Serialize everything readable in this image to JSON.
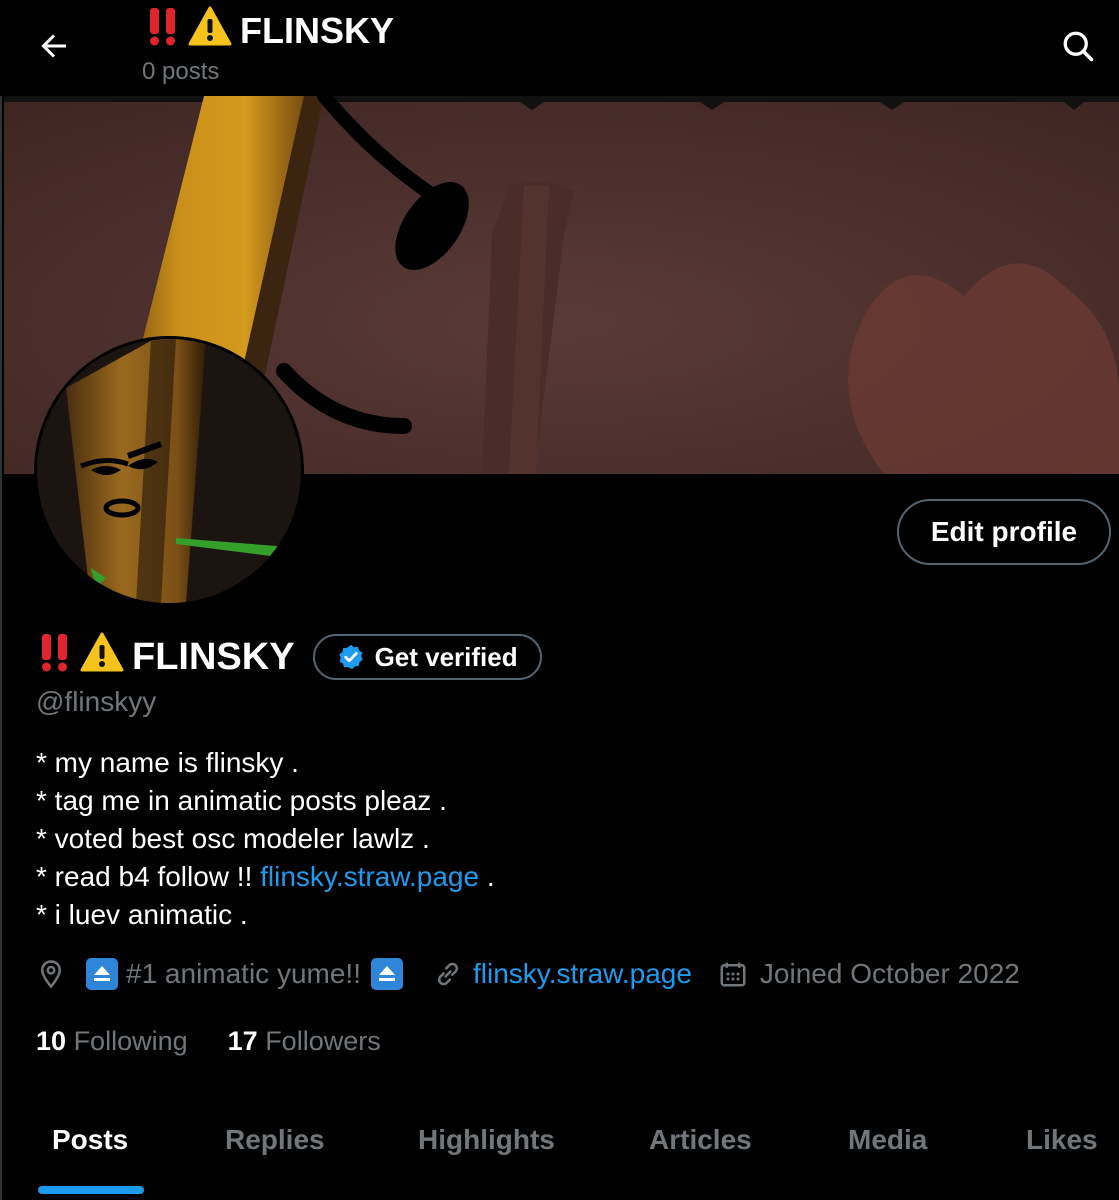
{
  "header": {
    "title": "FLINSKY",
    "title_emoji_1": "‼️",
    "title_emoji_2": "⚠️",
    "subtitle": "0 posts",
    "back_icon": "arrow-left-icon",
    "search_icon": "search-icon"
  },
  "profile": {
    "display_name": "FLINSKY",
    "name_emoji_1": "‼️",
    "name_emoji_2": "⚠️",
    "verify_label": "Get verified",
    "handle": "@flinskyy",
    "edit_label": "Edit profile",
    "bio": [
      "* my name is flinsky .",
      "* tag me in animatic posts pleaz .",
      "* voted best osc modeler lawlz ."
    ],
    "bio_line4_prefix": "* read b4 follow !! ",
    "bio_line4_link": "flinsky.straw.page",
    "bio_line4_suffix": " .",
    "bio_line5": "* i luev animatic .",
    "location": "#1 animatic yume!!",
    "website": "flinsky.straw.page",
    "joined": "Joined October 2022",
    "following_count": "10",
    "following_label": "Following",
    "followers_count": "17",
    "followers_label": "Followers"
  },
  "tabs": [
    {
      "label": "Posts",
      "active": true
    },
    {
      "label": "Replies"
    },
    {
      "label": "Highlights"
    },
    {
      "label": "Articles"
    },
    {
      "label": "Media"
    },
    {
      "label": "Likes"
    }
  ],
  "colors": {
    "accent": "#1d9bf0",
    "muted": "#71767b",
    "background": "#000000",
    "border": "#536471"
  }
}
